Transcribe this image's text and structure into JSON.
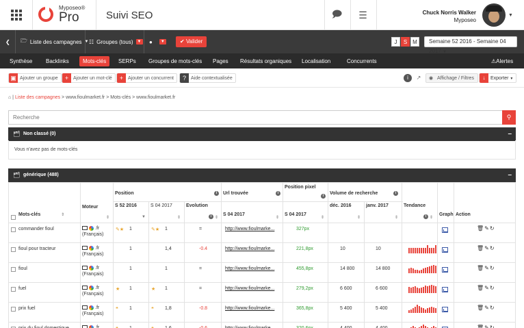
{
  "header": {
    "brand": "Myposeo®",
    "brand_pro": "Pro",
    "page_title": "Suivi SEO",
    "user_name": "Chuck Norris Walker",
    "user_company": "Myposeo"
  },
  "campaign_bar": {
    "campaigns_label": "Liste des campagnes",
    "groups_label": "Groupes (tous)",
    "validate_label": "Valider",
    "period_buttons": [
      "J",
      "S",
      "M"
    ],
    "period_active": "S",
    "week_range": "Semaine 52 2016 - Semaine 04 2017"
  },
  "nav": {
    "tabs": [
      "Synthèse",
      "Backlinks",
      "Mots-clés",
      "SERPs",
      "Groupes de mots-clés",
      "Pages",
      "Résultats organiques",
      "Localisation",
      "Concurrents"
    ],
    "active": "Mots-clés",
    "alerts_label": "Alertes"
  },
  "toolbar": {
    "add_group": "Ajouter un groupe",
    "add_keyword": "Ajouter un mot-clé",
    "add_competitor": "Ajouter un concurrent",
    "help": "Aide contextualisée",
    "display_filters": "Affichage / Filtres",
    "export": "Exporter"
  },
  "breadcrumb": {
    "link": "Liste des campagnes",
    "rest": " > www.fioulmarket.fr > Mots-clés > www.fioulmarket.fr"
  },
  "search": {
    "placeholder": "Recherche"
  },
  "panel_unclassified": {
    "title": "Non classé (0)",
    "empty_message": "Vous n'avez pas de mots-clés"
  },
  "panel_generic": {
    "title": "générique (488)"
  },
  "table": {
    "headers": {
      "keywords": "Mots-clés",
      "engine": "Moteur",
      "position": "Position",
      "pos_s52": "S 52 2016",
      "pos_s04": "S 04 2017",
      "evolution": "Evolution",
      "url_found": "Url trouvée",
      "url_s04": "S 04 2017",
      "pixel_position": "Position pixel",
      "pixel_s04": "S 04 2017",
      "search_volume": "Volume de recherche",
      "vol_dec": "déc. 2016",
      "vol_jan": "janv. 2017",
      "trend": "Tendance",
      "graph": "Graph",
      "action": "Action"
    },
    "rows": [
      {
        "keyword": "commander fioul",
        "engine": ".fr",
        "lang": "(Français)",
        "s52": "1",
        "s04": "1",
        "evolution": "=",
        "url": "http://www.fioulmarke...",
        "pixel": "327px",
        "vol_dec": "",
        "vol_jan": "",
        "trend": []
      },
      {
        "keyword": "fioul pour tracteur",
        "engine": ".fr",
        "lang": "(Français)",
        "s52": "1",
        "s04": "1,4",
        "evolution": "-0.4",
        "url": "http://www.fioulmarke...",
        "pixel": "221,8px",
        "vol_dec": "10",
        "vol_jan": "10",
        "trend": [
          2,
          2,
          2,
          2,
          2,
          2,
          2,
          2,
          2,
          3,
          2,
          2,
          2,
          3
        ]
      },
      {
        "keyword": "fioul",
        "engine": ".fr",
        "lang": "(Français)",
        "s52": "1",
        "s04": "1",
        "evolution": "=",
        "url": "http://www.fioulmarke...",
        "pixel": "455,8px",
        "vol_dec": "14 800",
        "vol_jan": "14 800",
        "trend": [
          6,
          7,
          6,
          5,
          5,
          4,
          5,
          6,
          7,
          8,
          9,
          10,
          11,
          10
        ]
      },
      {
        "keyword": "fuel",
        "engine": ".fr",
        "lang": "(Français)",
        "s52": "1",
        "s04": "1",
        "evolution": "=",
        "url": "http://www.fioulmarke...",
        "pixel": "279,2px",
        "vol_dec": "6 600",
        "vol_jan": "6 600",
        "trend": [
          9,
          8,
          9,
          10,
          8,
          7,
          8,
          9,
          11,
          10,
          11,
          12,
          11,
          10
        ]
      },
      {
        "keyword": "prix fuel",
        "engine": ".fr",
        "lang": "(Français)",
        "s52": "1",
        "s04": "1,8",
        "evolution": "-0.8",
        "url": "http://www.fioulmarke...",
        "pixel": "365,8px",
        "vol_dec": "5 400",
        "vol_jan": "5 400",
        "trend": [
          4,
          5,
          6,
          8,
          11,
          9,
          7,
          6,
          5,
          6,
          7,
          8,
          7,
          6
        ]
      },
      {
        "keyword": "prix du fioul domestique",
        "engine": ".fr",
        "lang": "(Français)",
        "s52": "1",
        "s04": "1,6",
        "evolution": "-0.6",
        "url": "http://www.fioulmarke...",
        "pixel": "320,6px",
        "vol_dec": "4 400",
        "vol_jan": "4 400",
        "trend": [
          3,
          4,
          5,
          4,
          3,
          4,
          5,
          6,
          5,
          4,
          3,
          4,
          5,
          4
        ]
      }
    ]
  },
  "colors": {
    "accent": "#e8433a",
    "dark": "#3a3a3a",
    "positive": "#2e9a2e"
  },
  "icons": [
    "apps-grid-icon",
    "chat-icon",
    "sliders-icon",
    "folder-icon",
    "sitemap-icon",
    "map-pin-icon",
    "check-icon",
    "warning-icon",
    "home-icon",
    "search-icon",
    "minus-icon",
    "monitor-icon",
    "google-icon",
    "graph-icon",
    "trash-icon",
    "edit-icon",
    "refresh-icon",
    "info-icon"
  ]
}
